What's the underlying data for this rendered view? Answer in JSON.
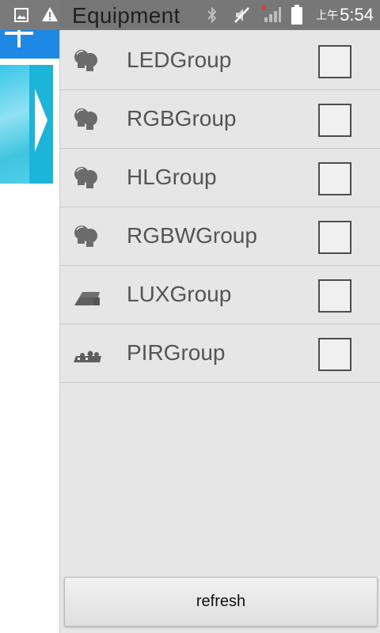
{
  "status_bar": {
    "title": "Equipment",
    "time_prefix": "上午",
    "time": "5:54"
  },
  "drawer": {
    "items": [
      {
        "label": "LEDGroup",
        "icon": "bulb-icon",
        "checked": false
      },
      {
        "label": "RGBGroup",
        "icon": "bulb-icon",
        "checked": false
      },
      {
        "label": "HLGroup",
        "icon": "bulb-icon",
        "checked": false
      },
      {
        "label": "RGBWGroup",
        "icon": "bulb-icon",
        "checked": false
      },
      {
        "label": "LUXGroup",
        "icon": "lux-sensor-icon",
        "checked": false
      },
      {
        "label": "PIRGroup",
        "icon": "pir-sensor-icon",
        "checked": false
      }
    ],
    "refresh_label": "refresh"
  },
  "colors": {
    "status_bar": "#777777",
    "drawer_bg": "#e6e6e6",
    "header_blue": "#1e88e5",
    "banner_cyan": "#1bb5d9"
  }
}
